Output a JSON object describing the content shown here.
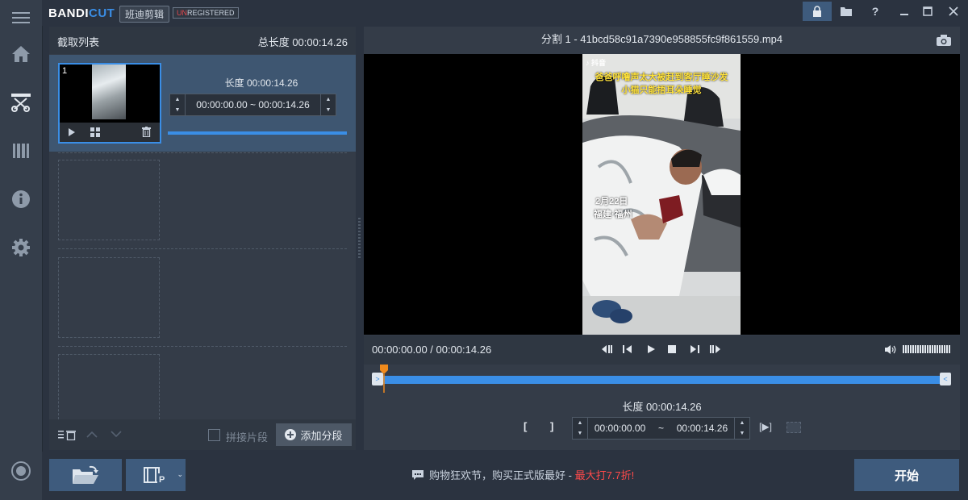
{
  "app": {
    "brand_main": "BANDI",
    "brand_cut": "CUT",
    "brand_cn": "班迪剪辑",
    "unreg_prefix": "UN",
    "unreg_suffix": "REGISTERED"
  },
  "nav": [
    "home-icon",
    "cut-icon",
    "film-icon",
    "info-icon",
    "gear-icon",
    "record-icon"
  ],
  "window_controls": [
    "lock-icon",
    "folder-icon",
    "help-icon",
    "minimize-icon",
    "maximize-icon",
    "close-icon"
  ],
  "left_panel": {
    "title": "截取列表",
    "total": "总长度 00:00:14.26",
    "clip": {
      "index": "1",
      "length": "长度 00:00:14.26",
      "start": "00:00:00.00",
      "sep": "~",
      "end": "00:00:14.26",
      "progress": 1.0
    },
    "footer": {
      "merge_label": "拼接片段",
      "merge_checked": false,
      "add_label": "添加分段"
    }
  },
  "right_panel": {
    "title": "分割 1 - 41bcd58c91a7390e958855fc9f861559.mp4",
    "video_overlay": {
      "app_label": "抖音",
      "caption_line1": "爸爸呼噜声太大被赶到客厅睡沙发",
      "caption_line2": "小猫只能捂耳朵睡觉",
      "date": "2月22日",
      "location": "福建·福州"
    },
    "time_display": "00:00:00.00 / 00:00:14.26",
    "segment_length": "长度 00:00:14.26",
    "seg_start": "00:00:00.00",
    "seg_sep": "~",
    "seg_end": "00:00:14.26",
    "bracket_open": "[",
    "bracket_close": "]",
    "play_sel": "[▶]"
  },
  "bottom": {
    "promo_text": "购物狂欢节，购买正式版最好 - ",
    "promo_hot": "最大打7.7折!",
    "start_label": "开始"
  },
  "colors": {
    "accent": "#3a8ee6",
    "panel": "#343c48",
    "bg": "#2b3340",
    "button": "#3e5b7d",
    "hot": "#ff4a4a",
    "playhead": "#f08a1c"
  }
}
